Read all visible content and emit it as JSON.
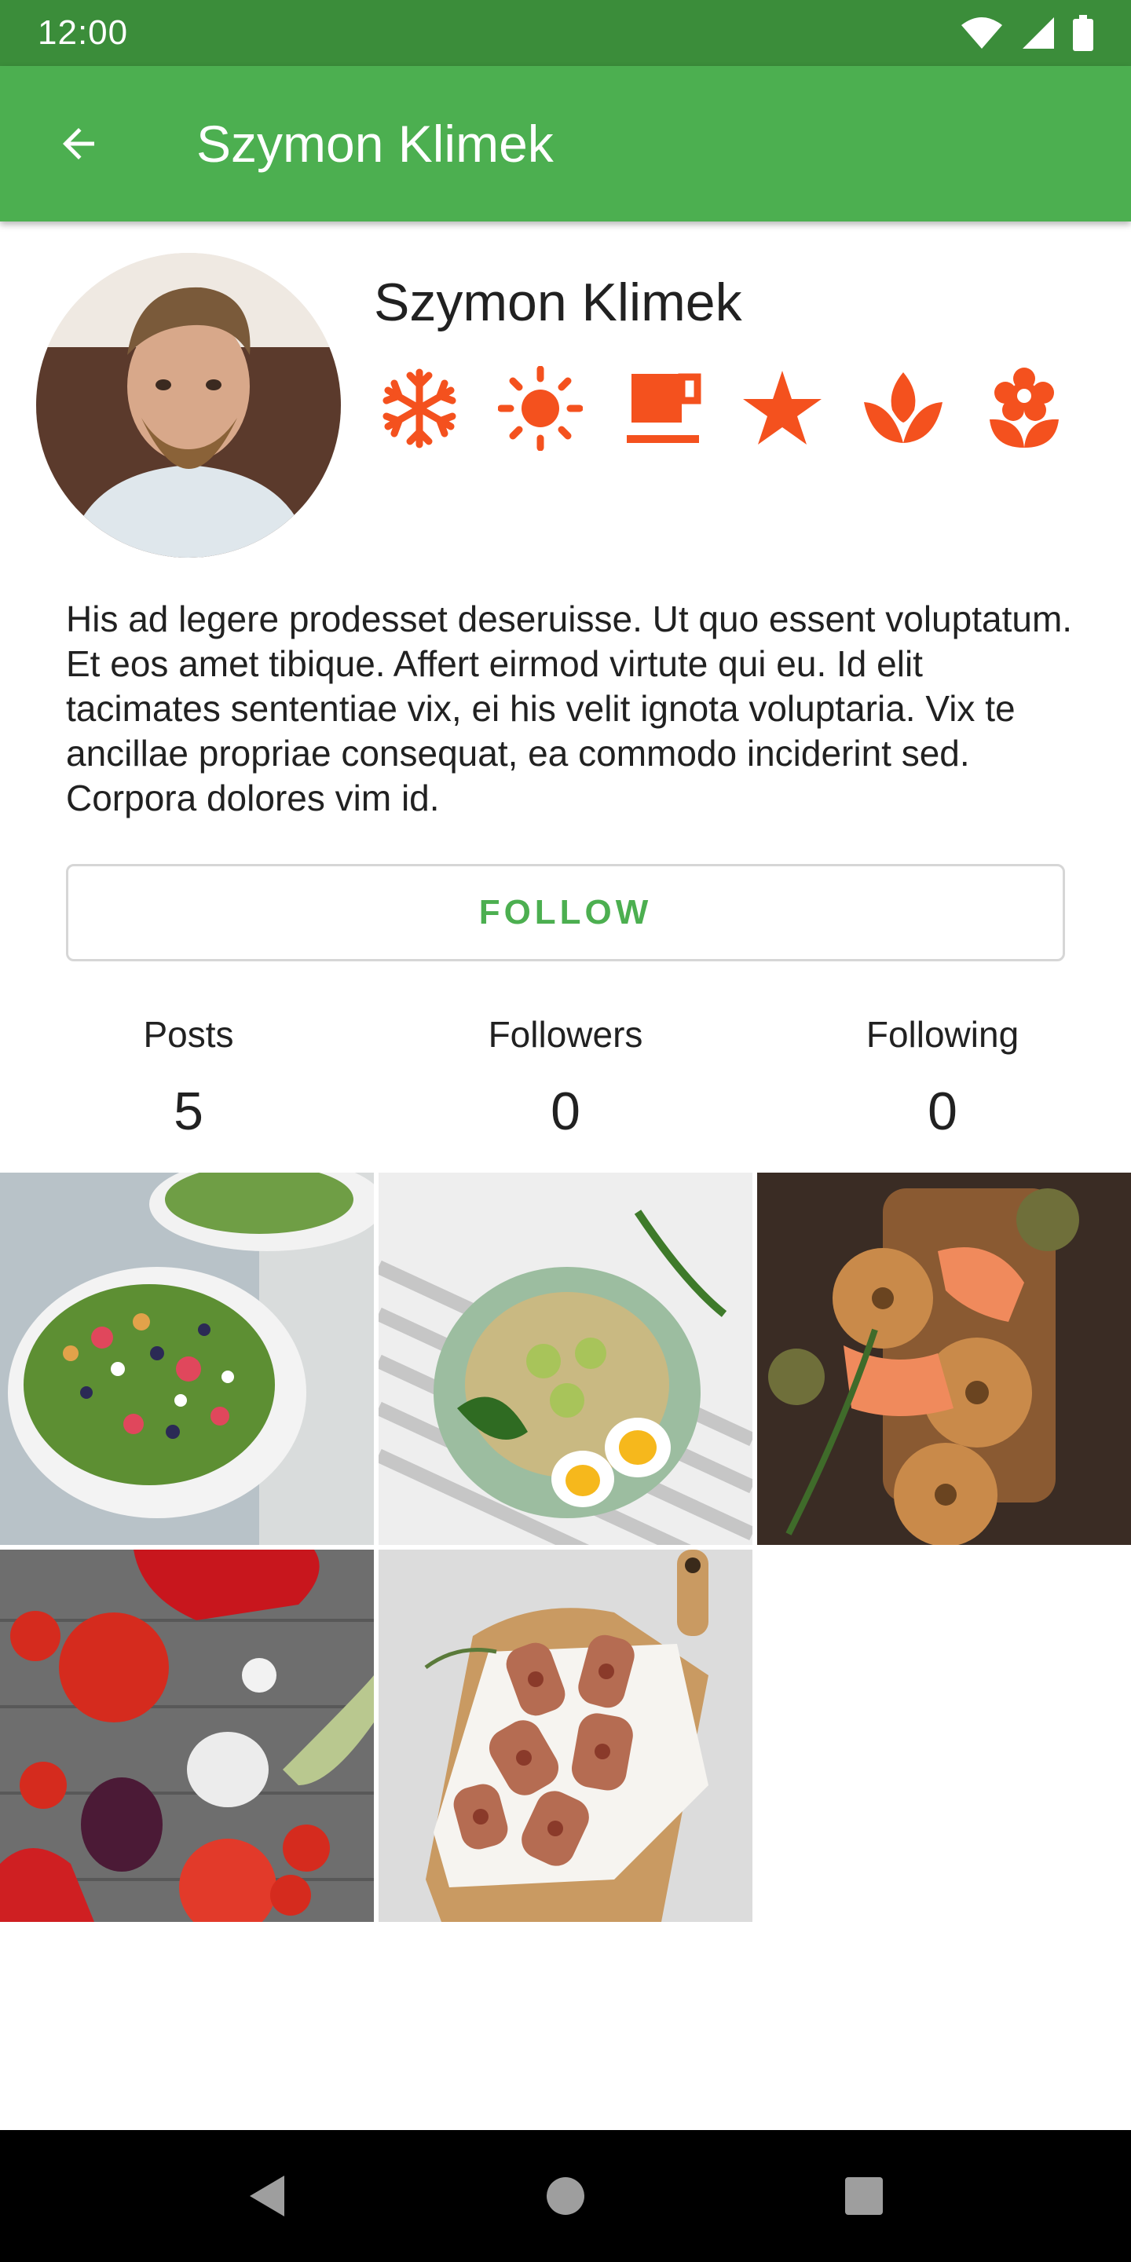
{
  "status_bar": {
    "time": "12:00",
    "icons": [
      "wifi-icon",
      "signal-icon",
      "battery-icon"
    ]
  },
  "app_bar": {
    "title": "Szymon Klimek",
    "back_icon": "arrow-back-icon"
  },
  "profile": {
    "name": "Szymon Klimek",
    "badges": [
      "snowflake-icon",
      "sun-icon",
      "coffee-icon",
      "star-icon",
      "lotus-icon",
      "flower-icon"
    ],
    "badge_color": "#f4511e",
    "bio": "His ad legere prodesset deseruisse. Ut quo essent voluptatum. Et eos amet tibique. Affert eirmod virtute qui eu. Id elit tacimates sententiae vix, ei his velit ignota voluptaria. Vix te ancillae propriae consequat, ea commodo inciderint sed. Corpora dolores vim id."
  },
  "follow_button": {
    "label": "FOLLOW"
  },
  "stats": [
    {
      "label": "Posts",
      "value": "5"
    },
    {
      "label": "Followers",
      "value": "0"
    },
    {
      "label": "Following",
      "value": "0"
    }
  ],
  "posts": [
    {
      "name": "salad-photo"
    },
    {
      "name": "rice-vegetables-photo"
    },
    {
      "name": "salmon-bagels-photo"
    },
    {
      "name": "vegetables-photo"
    },
    {
      "name": "bacon-rolls-photo"
    }
  ],
  "colors": {
    "primary": "#4caf50",
    "primary_dark": "#3b8d3a",
    "accent": "#f4511e"
  },
  "nav_bar": {
    "icons": [
      "back-triangle-icon",
      "home-circle-icon",
      "recents-square-icon"
    ]
  }
}
